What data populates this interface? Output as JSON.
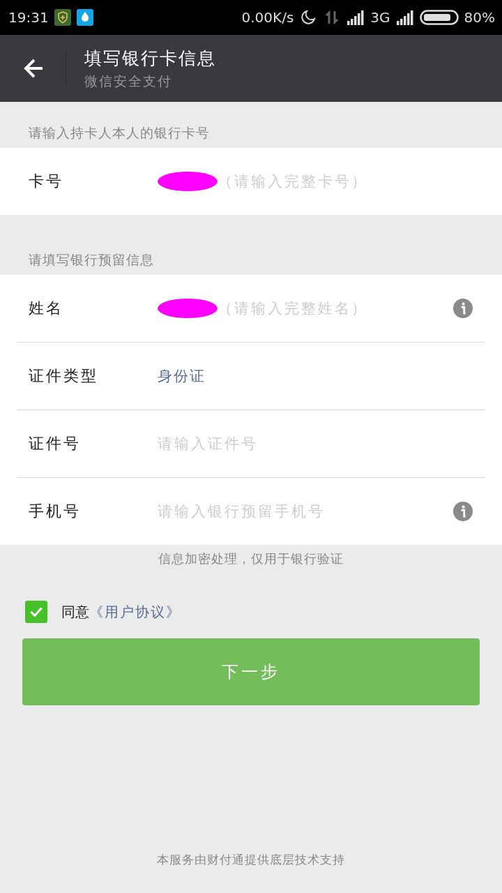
{
  "status_bar": {
    "time": "19:31",
    "net_speed": "0.00K/s",
    "network": "3G",
    "battery": "80%"
  },
  "header": {
    "title": "填写银行卡信息",
    "subtitle": "微信安全支付"
  },
  "sections": [
    {
      "label": "请输入持卡人本人的银行卡号",
      "rows": [
        {
          "label": "卡号",
          "kind": "input",
          "redacted": true,
          "placeholder": "（请输入完整卡号）",
          "info": false
        }
      ]
    },
    {
      "label": "请填写银行预留信息",
      "rows": [
        {
          "label": "姓名",
          "kind": "input",
          "redacted": true,
          "placeholder": "（请输入完整姓名）",
          "info": true
        },
        {
          "label": "证件类型",
          "kind": "select",
          "value": "身份证",
          "info": false
        },
        {
          "label": "证件号",
          "kind": "input",
          "redacted": false,
          "placeholder": "请输入证件号",
          "info": false
        },
        {
          "label": "手机号",
          "kind": "input",
          "redacted": false,
          "placeholder": "请输入银行预留手机号",
          "info": true
        }
      ]
    }
  ],
  "note": "信息加密处理，仅用于银行验证",
  "agreement": {
    "checked": true,
    "text": "同意",
    "link": "《用户协议》"
  },
  "next_button": {
    "label": "下一步",
    "disabled": true
  },
  "footer": "本服务由财付通提供底层技术支持"
}
